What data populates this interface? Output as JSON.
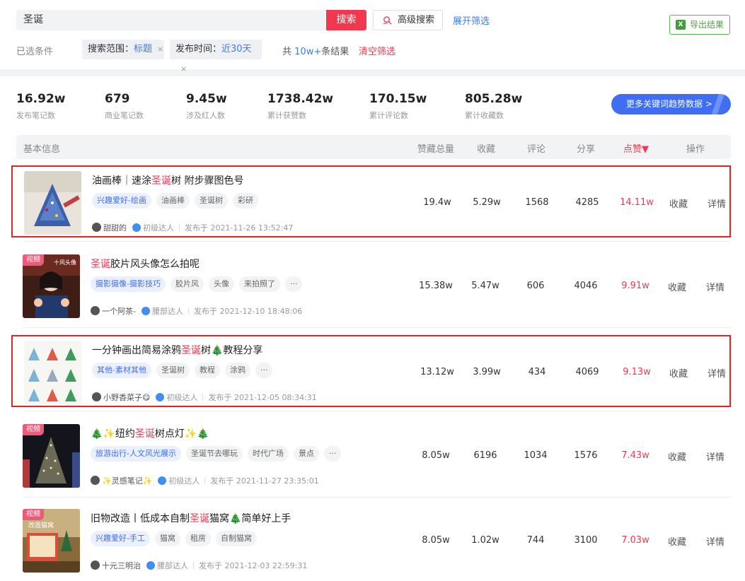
{
  "search": {
    "query": "圣诞",
    "button": "搜索",
    "advanced": "高级搜索",
    "expand": "展开筛选",
    "export": "导出结果"
  },
  "conditions": {
    "label": "已选条件",
    "chips": [
      {
        "key": "搜索范围：",
        "value": "标题",
        "close": "×"
      },
      {
        "key": "发布时间：",
        "value": "近30天",
        "close": "×"
      }
    ],
    "total_prefix": "共",
    "total_value": "10w+",
    "total_suffix": "条结果",
    "clear": "清空筛选"
  },
  "stats": [
    {
      "value": "16.92w",
      "label": "发布笔记数"
    },
    {
      "value": "679",
      "label": "商业笔记数"
    },
    {
      "value": "9.45w",
      "label": "涉及红人数"
    },
    {
      "value": "1738.42w",
      "label": "累计获赞数"
    },
    {
      "value": "170.15w",
      "label": "累计评论数"
    },
    {
      "value": "805.28w",
      "label": "累计收藏数"
    }
  ],
  "trend_button": "更多关键词趋势数据 >",
  "table": {
    "headers": {
      "basic": "基本信息",
      "likes_total": "赞藏总量",
      "favorites": "收藏",
      "comments": "评论",
      "shares": "分享",
      "likes": "点赞▼",
      "actions": "操作"
    }
  },
  "rows": [
    {
      "title_pre": "油画棒｜速涂",
      "title_kw": "圣诞",
      "title_post": "树 附步骤图色号",
      "video": "",
      "category": "兴趣爱好-绘画",
      "tags": [
        "油画棒",
        "圣诞树",
        "彩研"
      ],
      "author": "甜甜的",
      "level": "初级达人",
      "date": "发布于  2021-11-26 13:52:47",
      "total": "19.4w",
      "fav": "5.29w",
      "comments": "1568",
      "shares": "4285",
      "likes": "14.11w",
      "collect": "收藏",
      "detail": "详情",
      "highlight": true
    },
    {
      "title_pre": "",
      "title_kw": "圣诞",
      "title_post": "胶片风头像怎么拍呢",
      "video": "视频",
      "category": "摄影摄像-摄影技巧",
      "tags": [
        "胶片风",
        "头像",
        "来拍照了",
        "···"
      ],
      "author": "一个阿茶-",
      "level": "腰部达人",
      "date": "发布于  2021-12-10 18:48:06",
      "total": "15.38w",
      "fav": "5.47w",
      "comments": "606",
      "shares": "4046",
      "likes": "9.91w",
      "collect": "收藏",
      "detail": "详情",
      "highlight": false
    },
    {
      "title_pre": "一分钟画出简易涂鸦",
      "title_kw": "圣诞",
      "title_post": "树🎄教程分享",
      "video": "",
      "category": "其他-素材其他",
      "tags": [
        "圣诞树",
        "教程",
        "涂鸦",
        "···"
      ],
      "author": "小野香菜子😋",
      "level": "初级达人",
      "date": "发布于  2021-12-05 08:34:31",
      "total": "13.12w",
      "fav": "3.99w",
      "comments": "434",
      "shares": "4069",
      "likes": "9.13w",
      "collect": "收藏",
      "detail": "详情",
      "highlight": true
    },
    {
      "title_pre": "🎄✨纽约",
      "title_kw": "圣诞",
      "title_post": "树点灯✨🎄",
      "video": "视频",
      "category": "旅游出行-人文风光展示",
      "tags": [
        "圣诞节去哪玩",
        "时代广场",
        "景点",
        "···"
      ],
      "author": "✨灵感笔记✨",
      "level": "初级达人",
      "date": "发布于  2021-11-27 23:35:01",
      "total": "8.05w",
      "fav": "6196",
      "comments": "1034",
      "shares": "1576",
      "likes": "7.43w",
      "collect": "收藏",
      "detail": "详情",
      "highlight": false
    },
    {
      "title_pre": "旧物改造丨低成本自制",
      "title_kw": "圣诞",
      "title_post": "猫窝🎄简单好上手",
      "video": "视频",
      "category": "兴趣爱好-手工",
      "tags": [
        "猫窝",
        "租房",
        "自制猫窝"
      ],
      "author": "十元三明治",
      "level": "腰部达人",
      "date": "发布于  2021-12-03 22:59:31",
      "total": "8.05w",
      "fav": "1.02w",
      "comments": "744",
      "shares": "3100",
      "likes": "7.03w",
      "collect": "收藏",
      "detail": "详情",
      "highlight": false
    }
  ]
}
